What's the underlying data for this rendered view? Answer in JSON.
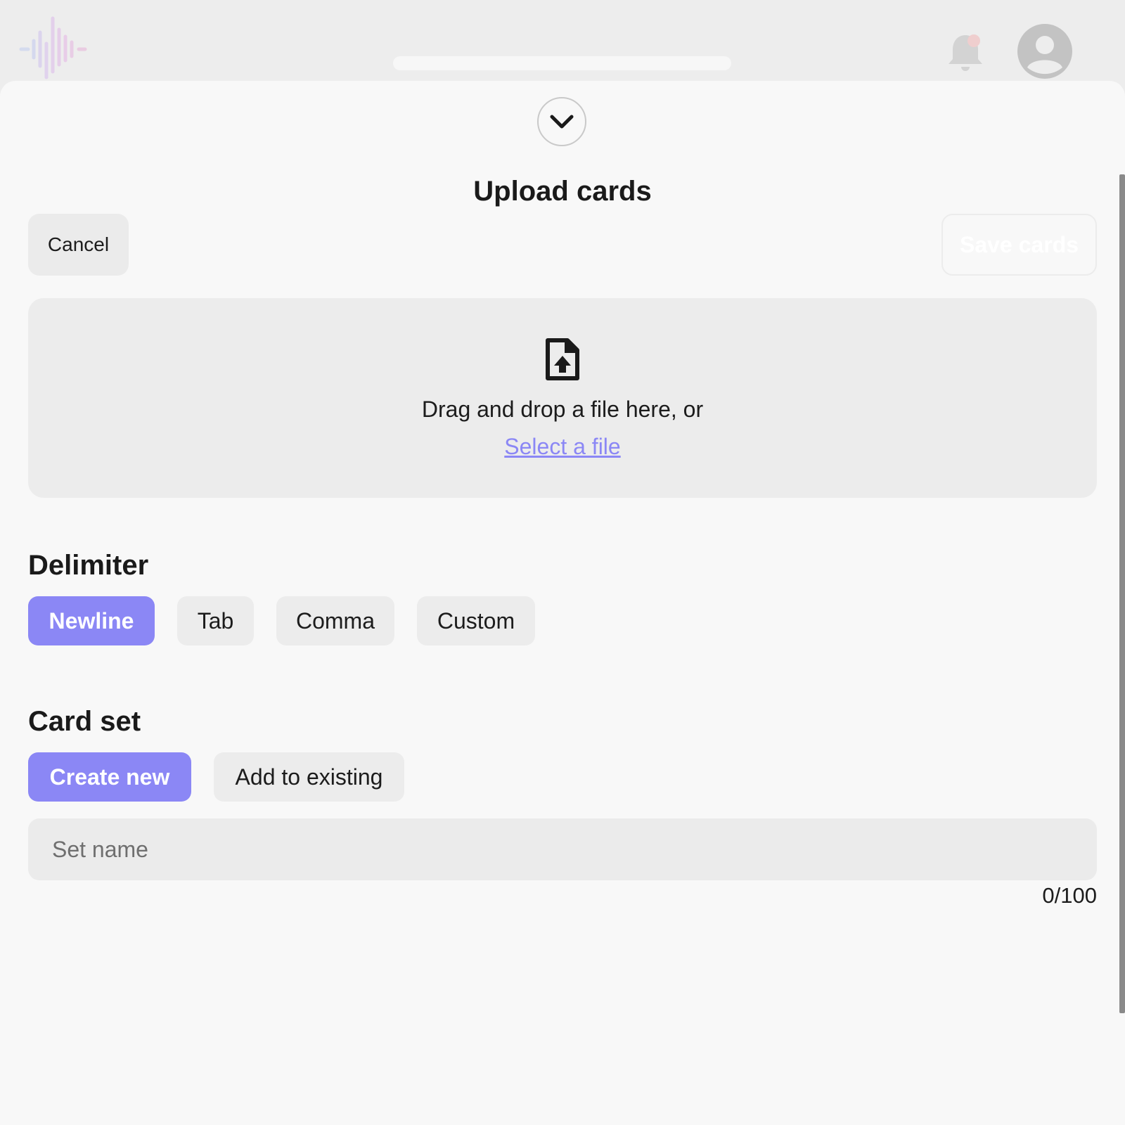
{
  "header": {
    "logo_icon": "audio-waveform-icon",
    "notification_icon": "bell-icon",
    "notification_dot_color": "#f3a9a9",
    "avatar_icon": "user-avatar-icon"
  },
  "sheet": {
    "collapse_icon": "chevron-down-icon",
    "title": "Upload cards",
    "cancel_label": "Cancel",
    "save_label": "Save cards"
  },
  "dropzone": {
    "icon": "file-upload-icon",
    "text": "Drag and drop a file here, or",
    "link_text": "Select a file"
  },
  "delimiter": {
    "heading": "Delimiter",
    "options": [
      "Newline",
      "Tab",
      "Comma",
      "Custom"
    ],
    "selected": "Newline"
  },
  "card_set": {
    "heading": "Card set",
    "options": [
      "Create new",
      "Add to existing"
    ],
    "selected": "Create new",
    "name_value": "",
    "name_placeholder": "Set name",
    "counter": "0/100"
  },
  "colors": {
    "accent": "#8b87f5",
    "background": "#f8f8f8",
    "chip_bg": "#ececec"
  }
}
